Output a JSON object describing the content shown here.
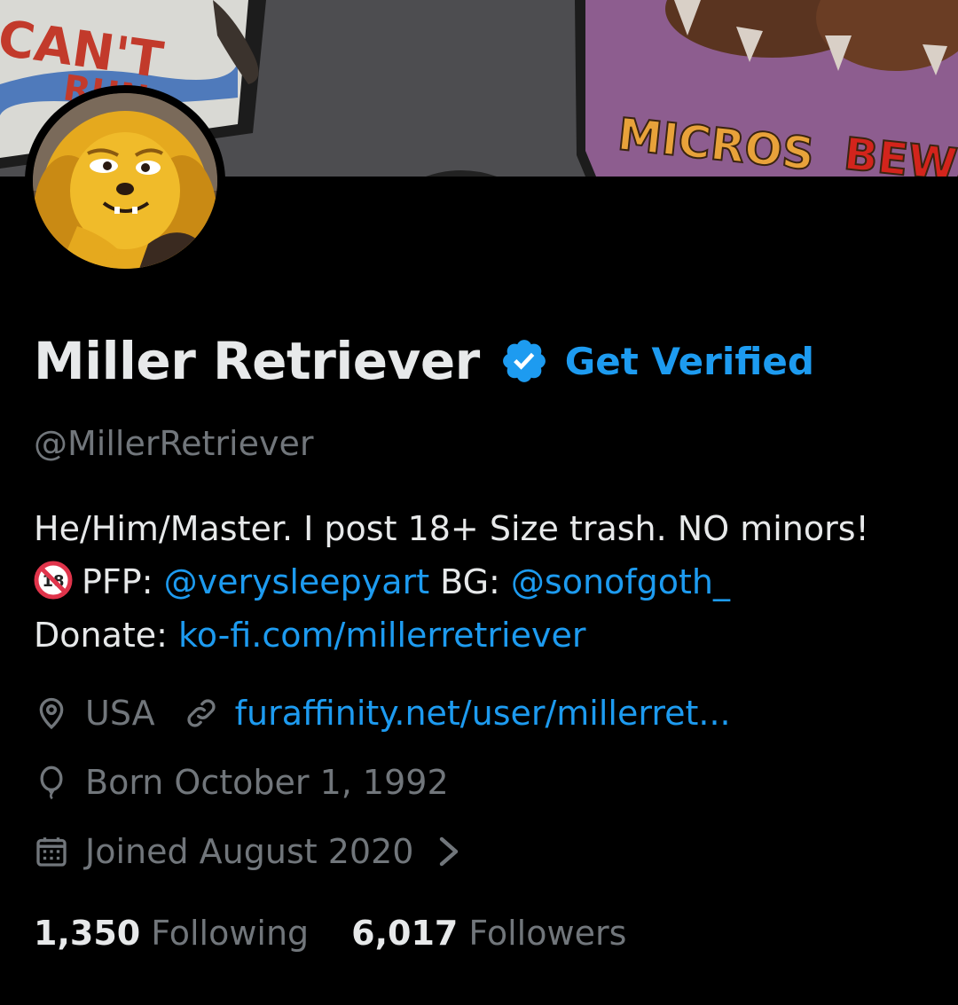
{
  "banner": {
    "sign_left_text": "CAN'T",
    "sign_left_text2": "RUN",
    "sign_right_text1": "MICROS",
    "sign_right_text2": "BEW/"
  },
  "profile": {
    "display_name": "Miller Retriever",
    "get_verified_label": "Get Verified",
    "handle": "@MillerRetriever"
  },
  "bio": {
    "line1": "He/Him/Master. I post 18+ Size trash. NO minors!",
    "pfp_label": "PFP: ",
    "pfp_link": "@verysleepyart",
    "bg_label": " BG: ",
    "bg_link": "@sonofgoth_",
    "donate_label": "Donate: ",
    "donate_link": "ko-fi.com/millerretriever"
  },
  "meta": {
    "location": "USA",
    "website": "furaffinity.net/user/millerret...",
    "birthday": "Born October 1, 1992",
    "joined": "Joined August 2020"
  },
  "stats": {
    "following_count": "1,350",
    "following_label": "Following",
    "followers_count": "6,017",
    "followers_label": "Followers"
  },
  "colors": {
    "background": "#000000",
    "primary_text": "#e7e9ea",
    "secondary_text": "#71767b",
    "accent": "#1d9bf0"
  }
}
